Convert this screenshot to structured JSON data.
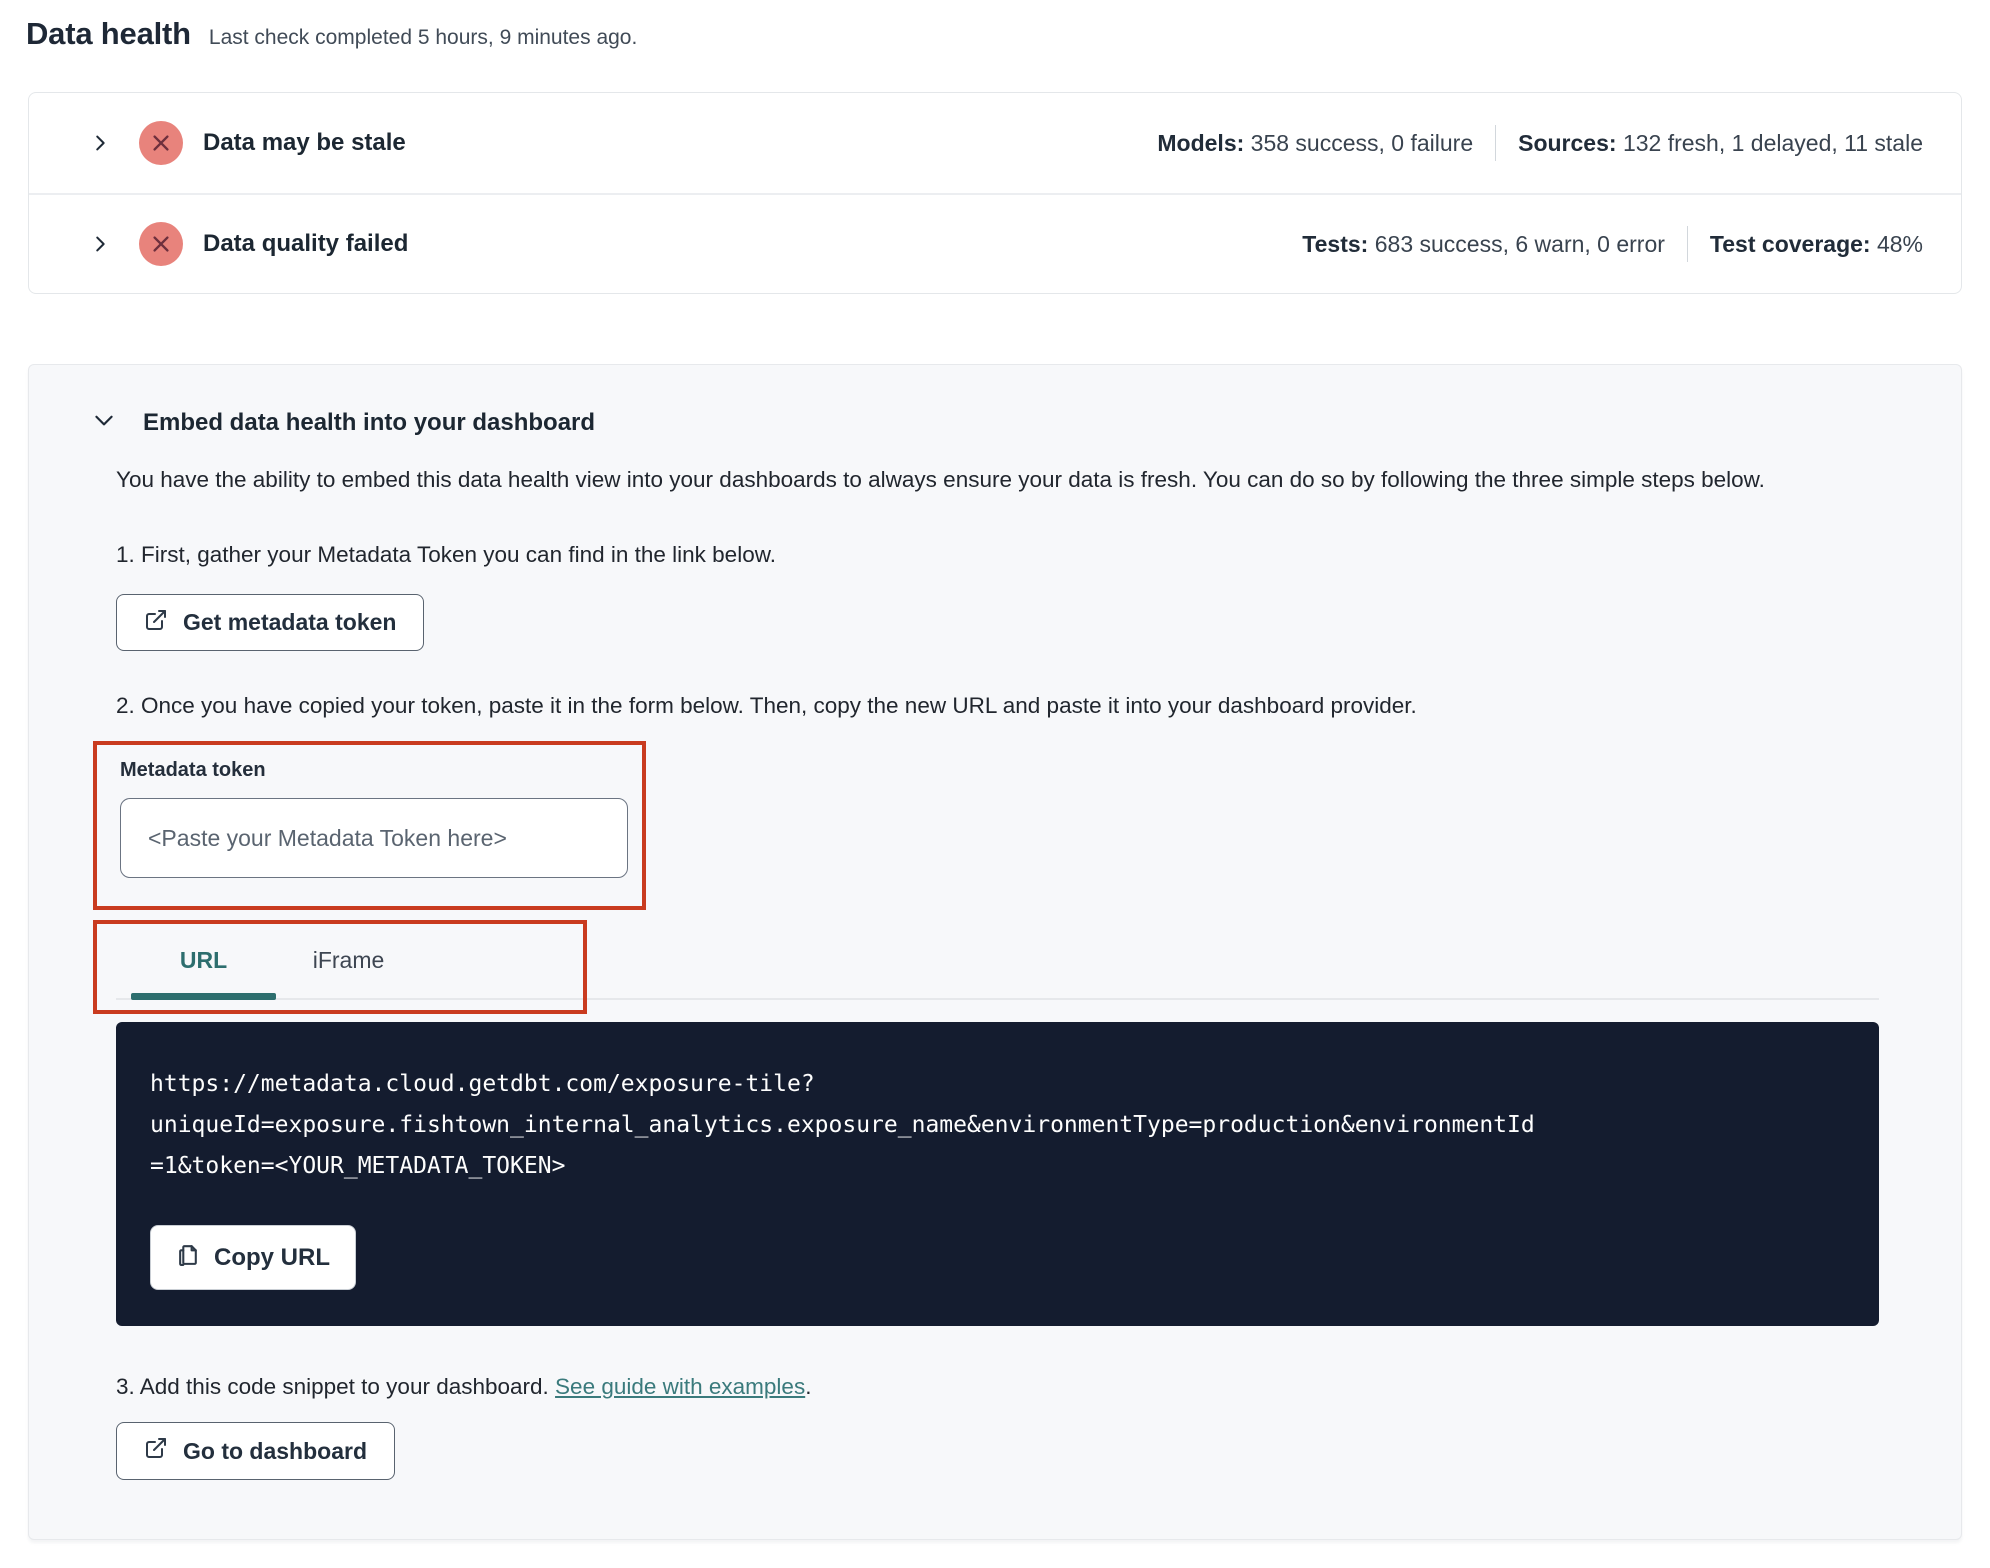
{
  "page": {
    "title": "Data health",
    "subtitle": "Last check completed 5 hours, 9 minutes ago."
  },
  "status_rows": [
    {
      "title": "Data may be stale",
      "icon": "x-circle",
      "stats": [
        {
          "label": "Models:",
          "value": "358 success, 0 failure"
        },
        {
          "label": "Sources:",
          "value": "132 fresh, 1 delayed, 11 stale"
        }
      ]
    },
    {
      "title": "Data quality failed",
      "icon": "x-circle",
      "stats": [
        {
          "label": "Tests:",
          "value": "683 success, 6 warn, 0 error"
        },
        {
          "label": "Test coverage:",
          "value": "48%"
        }
      ]
    }
  ],
  "embed": {
    "header": "Embed data health into your dashboard",
    "description": "You have the ability to embed this data health view into your dashboards to always ensure your data is fresh. You can do so by following the three simple steps below.",
    "step1": "1. First, gather your Metadata Token you can find in the link below.",
    "get_token_button": "Get metadata token",
    "step2": "2. Once you have copied your token, paste it in the form below. Then, copy the new URL and paste it into your dashboard provider.",
    "token_field": {
      "label": "Metadata token",
      "value": "",
      "placeholder": "<Paste your Metadata Token here>"
    },
    "tabs": [
      {
        "label": "URL",
        "active": true
      },
      {
        "label": "iFrame",
        "active": false
      }
    ],
    "code_block": {
      "lines": [
        "https://metadata.cloud.getdbt.com/exposure-tile?",
        "uniqueId=exposure.fishtown_internal_analytics.exposure_name&environmentType=production&environmentId",
        "=1&token=<YOUR_METADATA_TOKEN>"
      ],
      "copy_button": "Copy URL"
    },
    "step3_prefix": "3. Add this code snippet to your dashboard. ",
    "step3_link": "See guide with examples",
    "step3_suffix": ".",
    "dashboard_button": "Go to dashboard"
  },
  "colors": {
    "accent_teal": "#2d6e6e",
    "annotation_red": "#c93b1f",
    "status_icon_bg": "#e8837c",
    "status_icon_x": "#6e2f3d",
    "code_bg": "#141c2f"
  }
}
